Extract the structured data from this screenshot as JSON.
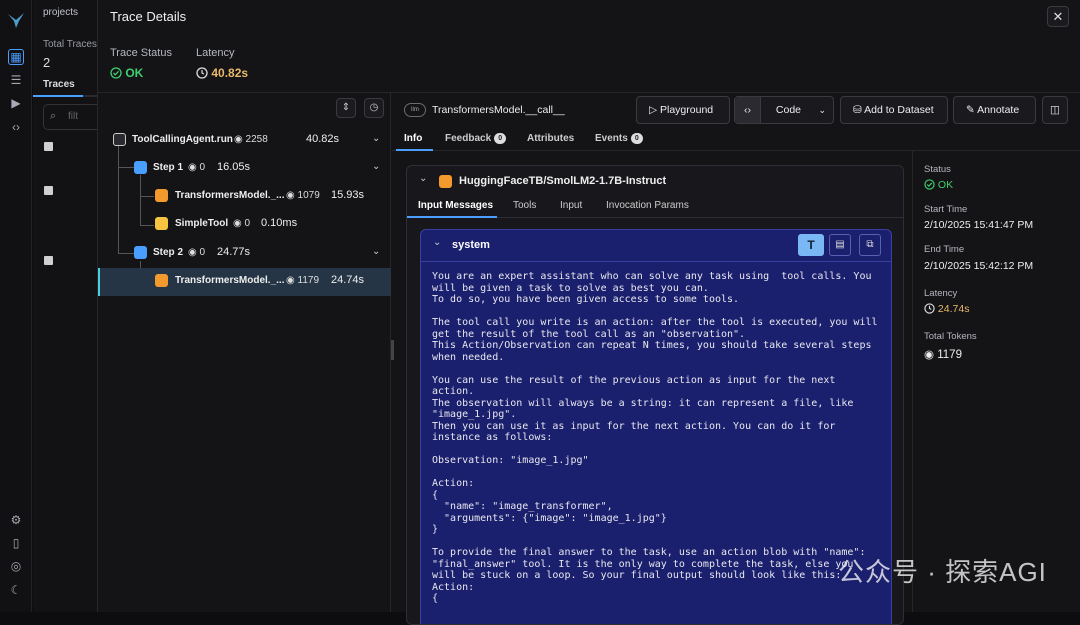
{
  "nav": {
    "breadcrumb": "projects",
    "total_traces_label": "Total Traces",
    "total_traces_value": "2",
    "traces_tab": "Traces",
    "search_placeholder": "filt"
  },
  "modal": {
    "title": "Trace Details",
    "close": "✕"
  },
  "summary": {
    "status_label": "Trace Status",
    "status_value": "OK",
    "latency_label": "Latency",
    "latency_value": "40.82s"
  },
  "tree": [
    {
      "name": "ToolCallingAgent.run",
      "tokens": "2258",
      "latency": "40.82s",
      "color": "#ffffff",
      "kind": "agent"
    },
    {
      "name": "Step 1",
      "tokens": "0",
      "latency": "16.05s",
      "color": "#4a9eff",
      "kind": "chain"
    },
    {
      "name": "TransformersModel._...",
      "tokens": "1079",
      "latency": "15.93s",
      "color": "#f29a2e",
      "kind": "llm"
    },
    {
      "name": "SimpleTool",
      "tokens": "0",
      "latency": "0.10ms",
      "color": "#f5c542",
      "kind": "tool"
    },
    {
      "name": "Step 2",
      "tokens": "0",
      "latency": "24.77s",
      "color": "#4a9eff",
      "kind": "chain"
    },
    {
      "name": "TransformersModel._...",
      "tokens": "1179",
      "latency": "24.74s",
      "color": "#f29a2e",
      "kind": "llm"
    }
  ],
  "span": {
    "kind_badge": "llm",
    "name": "TransformersModel.__call__"
  },
  "buttons": {
    "playground": "Playground",
    "code": "Code",
    "add_dataset": "Add to Dataset",
    "annotate": "Annotate"
  },
  "tabs": [
    {
      "label": "Info",
      "count": ""
    },
    {
      "label": "Feedback",
      "count": "0"
    },
    {
      "label": "Attributes",
      "count": ""
    },
    {
      "label": "Events",
      "count": "0"
    }
  ],
  "panel": {
    "model": "HuggingFaceTB/SmolLM2-1.7B-Instruct",
    "subtabs": [
      "Input Messages",
      "Tools",
      "Input",
      "Invocation Params"
    ],
    "role": "system",
    "content": "You are an expert assistant who can solve any task using  tool calls. You\nwill be given a task to solve as best you can.\nTo do so, you have been given access to some tools.\n\nThe tool call you write is an action: after the tool is executed, you will\nget the result of the tool call as an \"observation\".\nThis Action/Observation can repeat N times, you should take several steps\nwhen needed.\n\nYou can use the result of the previous action as input for the next\naction.\nThe observation will always be a string: it can represent a file, like\n\"image_1.jpg\".\nThen you can use it as input for the next action. You can do it for\ninstance as follows:\n\nObservation: \"image_1.jpg\"\n\nAction:\n{\n  \"name\": \"image_transformer\",\n  \"arguments\": {\"image\": \"image_1.jpg\"}\n}\n\nTo provide the final answer to the task, use an action blob with \"name\":\n\"final_answer\" tool. It is the only way to complete the task, else you\nwill be stuck on a loop. So your final output should look like this:\nAction:\n{"
  },
  "details": {
    "status_label": "Status",
    "status_value": "OK",
    "start_label": "Start Time",
    "start_value": "2/10/2025 15:41:47 PM",
    "end_label": "End Time",
    "end_value": "2/10/2025 15:42:12 PM",
    "latency_label": "Latency",
    "latency_value": "24.74s",
    "tokens_label": "Total Tokens",
    "tokens_value": "1179"
  },
  "watermark": "公众号 · 探索AGI",
  "colors": {
    "ok": "#3fcf6e",
    "latency": "#e9b86a",
    "accent": "#4a9eff",
    "message_bg": "#1a1f6e"
  }
}
